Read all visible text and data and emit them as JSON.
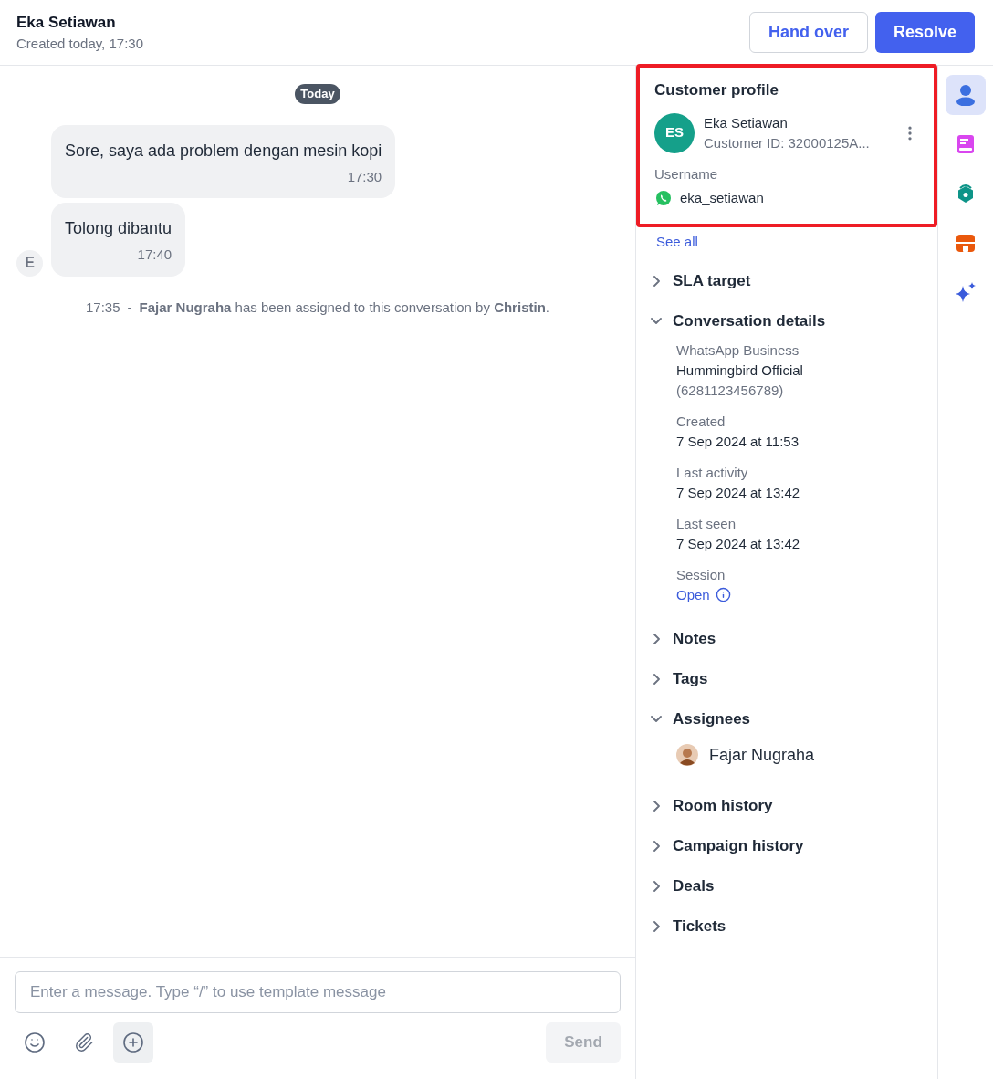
{
  "header": {
    "title": "Eka Setiawan",
    "subtitle": "Created today, 17:30",
    "buttons": [
      {
        "label": "Hand over",
        "kind": "secondary"
      },
      {
        "label": "Resolve",
        "kind": "primary"
      }
    ]
  },
  "chat": {
    "date_badge": "Today",
    "avatar": "E",
    "messages": [
      {
        "text": "Sore, saya ada problem dengan mesin kopi",
        "time": "17:30"
      },
      {
        "text": "Tolong dibantu",
        "time": "17:40"
      }
    ],
    "system_event": {
      "time": "17:35",
      "separator": "-",
      "text": "**Fajar Nugraha** has been assigned to this conversation by **Christin**."
    }
  },
  "composer": {
    "placeholder": "Enter a message. Type “/” to use template message",
    "tools": [
      {
        "kind": "emoji",
        "selected": false
      },
      {
        "kind": "attach",
        "selected": false
      },
      {
        "kind": "plus",
        "selected": true
      }
    ],
    "send": {
      "label": "Send",
      "disabled": true
    }
  },
  "profile": {
    "title": "Customer profile",
    "initials": "ES",
    "name": "Eka Setiawan",
    "customer_id": "Customer ID: 32000125A...",
    "username_label": "Username",
    "username": "eka_setiawan",
    "see_all": "See all"
  },
  "sections": [
    {
      "title": "SLA target",
      "expanded": false
    },
    {
      "title": "Conversation details",
      "expanded": true,
      "kind": "fields",
      "fields": [
        {
          "label": "WhatsApp Business",
          "value": "Hummingbird Official",
          "extra": "(6281123456789)"
        },
        {
          "label": "Created",
          "value": "7 Sep 2024 at 11:53"
        },
        {
          "label": "Last activity",
          "value": "7 Sep 2024 at 13:42"
        },
        {
          "label": "Last seen",
          "value": "7 Sep 2024 at 13:42"
        },
        {
          "label": "Session",
          "value": "Open",
          "kind": "link"
        }
      ]
    },
    {
      "title": "Notes",
      "expanded": false
    },
    {
      "title": "Tags",
      "expanded": false
    },
    {
      "title": "Assignees",
      "expanded": true,
      "kind": "people",
      "people": [
        "Fajar Nugraha"
      ]
    },
    {
      "title": "Room history",
      "expanded": false
    },
    {
      "title": "Campaign history",
      "expanded": false
    },
    {
      "title": "Deals",
      "expanded": false
    },
    {
      "title": "Tickets",
      "expanded": false
    }
  ],
  "rail": [
    {
      "kind": "person",
      "selected": true
    },
    {
      "kind": "notebook",
      "selected": false
    },
    {
      "kind": "badge",
      "selected": false
    },
    {
      "kind": "store",
      "selected": false
    },
    {
      "kind": "sparkle",
      "selected": false
    }
  ]
}
